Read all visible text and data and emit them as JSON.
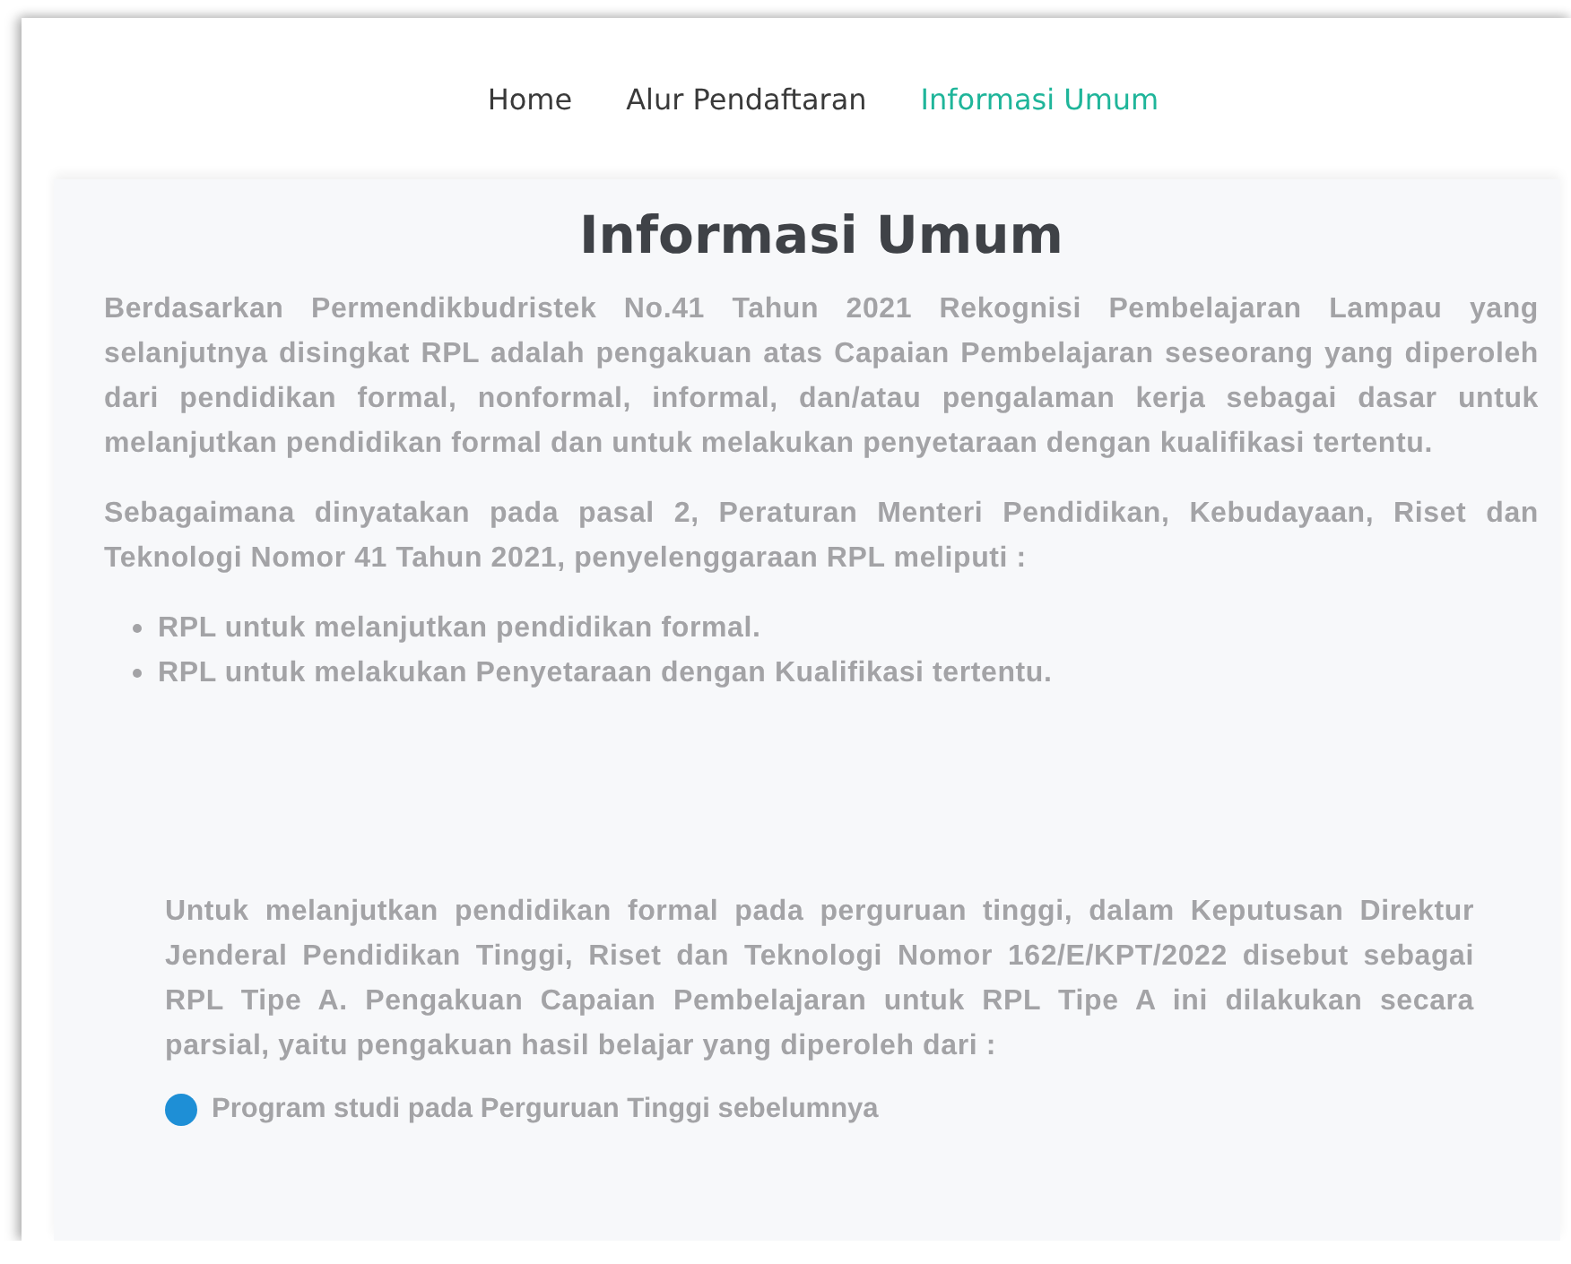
{
  "nav": [
    {
      "label": "Home",
      "selected": false
    },
    {
      "label": "Alur Pendaftaran",
      "selected": false
    },
    {
      "label": "Informasi Umum",
      "selected": true
    }
  ],
  "title": "Informasi Umum",
  "intro": [
    "Berdasarkan Permendikbudristek No.41 Tahun 2021 Rekognisi Pembelajaran Lampau yang selanjutnya disingkat RPL adalah pengakuan atas Capaian Pembelajaran seseorang yang diperoleh dari pendidikan formal, nonformal, informal, dan/atau pengalaman kerja sebagai dasar untuk melanjutkan pendidikan formal dan untuk melakukan penyetaraan dengan kualifikasi tertentu.",
    "Sebagaimana dinyatakan pada pasal 2, Peraturan Menteri Pendidikan, Kebudayaan, Riset dan Teknologi Nomor 41 Tahun 2021, penyelenggaraan RPL meliputi :"
  ],
  "bullets": [
    "RPL untuk melanjutkan pendidikan formal.",
    "RPL untuk melakukan Penyetaraan dengan Kualifikasi tertentu."
  ],
  "section": {
    "text": "Untuk melanjutkan pendidikan formal pada perguruan tinggi, dalam Keputusan Direktur Jenderal Pendidikan Tinggi, Riset dan Teknologi Nomor 162/E/KPT/2022 disebut sebagai RPL Tipe A. Pengakuan Capaian Pembelajaran untuk RPL Tipe A ini dilakukan secara parsial, yaitu pengakuan hasil belajar yang diperoleh dari :",
    "items": [
      "Program studi pada Perguruan Tinggi sebelumnya"
    ]
  }
}
